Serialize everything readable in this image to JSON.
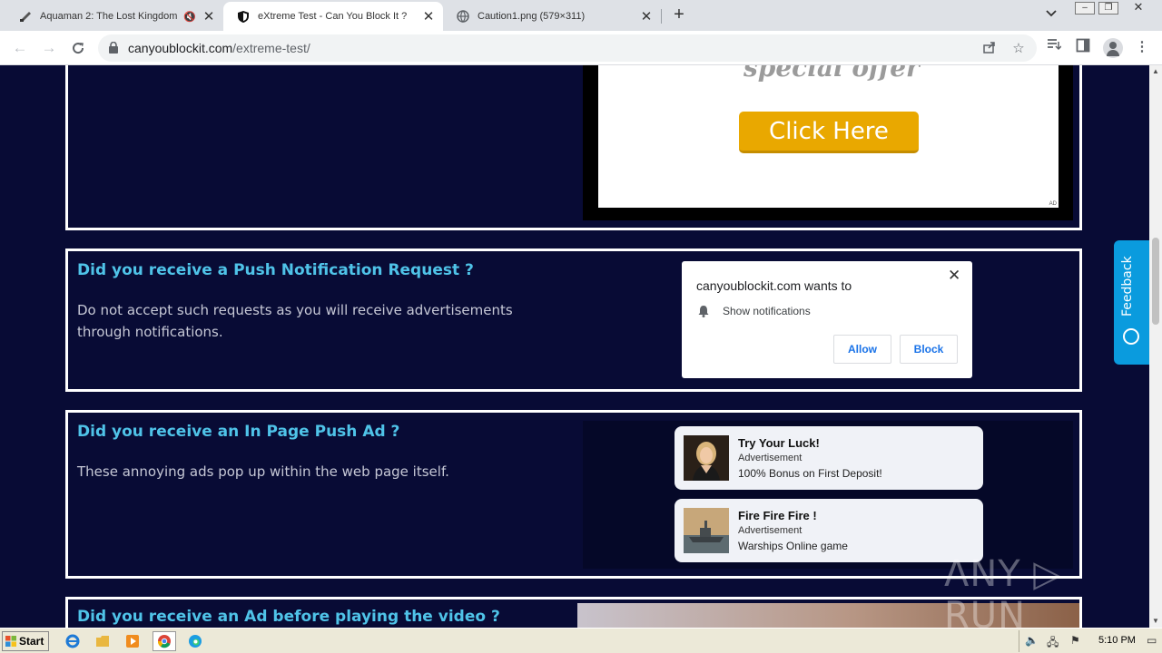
{
  "browser": {
    "tabs": [
      {
        "title": "Aquaman 2: The Lost Kingdom S",
        "muted_icon": "speaker-mute-icon",
        "active": false
      },
      {
        "title": "eXtreme Test - Can You Block It ?",
        "active": true
      },
      {
        "title": "Caution1.png (579×311)",
        "active": false
      }
    ],
    "close_glyph": "✕",
    "new_tab_glyph": "+",
    "address": {
      "domain": "canyoublockit.com",
      "path": "/extreme-test/"
    }
  },
  "page": {
    "card1": {
      "ad_offer_text": "special offer",
      "ad_button": "Click Here",
      "ad_tag": "AD"
    },
    "card2": {
      "heading": "Did you receive a Push Notification Request ?",
      "body": "Do not accept such requests as you will receive advertisements through notifications.",
      "prompt": {
        "site": "canyoublockit.com wants to",
        "permission": "Show notifications",
        "allow": "Allow",
        "block": "Block",
        "close": "✕"
      }
    },
    "card3": {
      "heading": "Did you receive an In Page Push Ad ?",
      "body": "These annoying ads pop up within the web page itself.",
      "pushes": [
        {
          "title": "Try Your Luck!",
          "label": "Advertisement",
          "text": "100% Bonus on First Deposit!"
        },
        {
          "title": "Fire Fire Fire !",
          "label": "Advertisement",
          "text": "Warships Online game"
        }
      ]
    },
    "card4": {
      "heading": "Did you receive an Ad before playing the video ?"
    },
    "feedback": "Feedback",
    "watermark": "ANY ▷ RUN"
  },
  "taskbar": {
    "start": "Start",
    "clock": "5:10 PM"
  },
  "colors": {
    "page_bg": "#080b35",
    "heading": "#4fc3e8",
    "cta": "#e9a800",
    "feedback": "#0a9bde",
    "link_blue": "#1a73e8"
  }
}
